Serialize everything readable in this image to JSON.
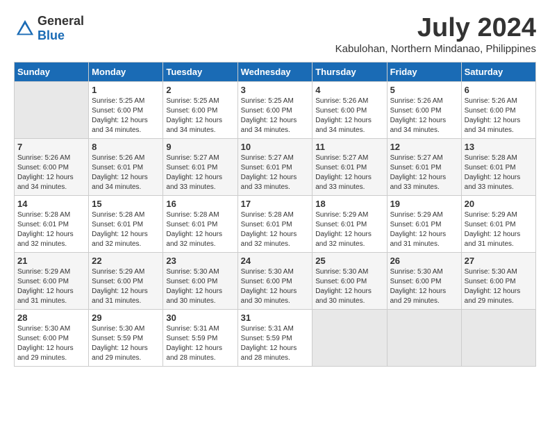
{
  "logo": {
    "text_general": "General",
    "text_blue": "Blue"
  },
  "title": {
    "month_year": "July 2024",
    "location": "Kabulohan, Northern Mindanao, Philippines"
  },
  "calendar": {
    "days_of_week": [
      "Sunday",
      "Monday",
      "Tuesday",
      "Wednesday",
      "Thursday",
      "Friday",
      "Saturday"
    ],
    "weeks": [
      [
        {
          "day": "",
          "info": ""
        },
        {
          "day": "1",
          "info": "Sunrise: 5:25 AM\nSunset: 6:00 PM\nDaylight: 12 hours\nand 34 minutes."
        },
        {
          "day": "2",
          "info": "Sunrise: 5:25 AM\nSunset: 6:00 PM\nDaylight: 12 hours\nand 34 minutes."
        },
        {
          "day": "3",
          "info": "Sunrise: 5:25 AM\nSunset: 6:00 PM\nDaylight: 12 hours\nand 34 minutes."
        },
        {
          "day": "4",
          "info": "Sunrise: 5:26 AM\nSunset: 6:00 PM\nDaylight: 12 hours\nand 34 minutes."
        },
        {
          "day": "5",
          "info": "Sunrise: 5:26 AM\nSunset: 6:00 PM\nDaylight: 12 hours\nand 34 minutes."
        },
        {
          "day": "6",
          "info": "Sunrise: 5:26 AM\nSunset: 6:00 PM\nDaylight: 12 hours\nand 34 minutes."
        }
      ],
      [
        {
          "day": "7",
          "info": "Sunrise: 5:26 AM\nSunset: 6:00 PM\nDaylight: 12 hours\nand 34 minutes."
        },
        {
          "day": "8",
          "info": "Sunrise: 5:26 AM\nSunset: 6:01 PM\nDaylight: 12 hours\nand 34 minutes."
        },
        {
          "day": "9",
          "info": "Sunrise: 5:27 AM\nSunset: 6:01 PM\nDaylight: 12 hours\nand 33 minutes."
        },
        {
          "day": "10",
          "info": "Sunrise: 5:27 AM\nSunset: 6:01 PM\nDaylight: 12 hours\nand 33 minutes."
        },
        {
          "day": "11",
          "info": "Sunrise: 5:27 AM\nSunset: 6:01 PM\nDaylight: 12 hours\nand 33 minutes."
        },
        {
          "day": "12",
          "info": "Sunrise: 5:27 AM\nSunset: 6:01 PM\nDaylight: 12 hours\nand 33 minutes."
        },
        {
          "day": "13",
          "info": "Sunrise: 5:28 AM\nSunset: 6:01 PM\nDaylight: 12 hours\nand 33 minutes."
        }
      ],
      [
        {
          "day": "14",
          "info": "Sunrise: 5:28 AM\nSunset: 6:01 PM\nDaylight: 12 hours\nand 32 minutes."
        },
        {
          "day": "15",
          "info": "Sunrise: 5:28 AM\nSunset: 6:01 PM\nDaylight: 12 hours\nand 32 minutes."
        },
        {
          "day": "16",
          "info": "Sunrise: 5:28 AM\nSunset: 6:01 PM\nDaylight: 12 hours\nand 32 minutes."
        },
        {
          "day": "17",
          "info": "Sunrise: 5:28 AM\nSunset: 6:01 PM\nDaylight: 12 hours\nand 32 minutes."
        },
        {
          "day": "18",
          "info": "Sunrise: 5:29 AM\nSunset: 6:01 PM\nDaylight: 12 hours\nand 32 minutes."
        },
        {
          "day": "19",
          "info": "Sunrise: 5:29 AM\nSunset: 6:01 PM\nDaylight: 12 hours\nand 31 minutes."
        },
        {
          "day": "20",
          "info": "Sunrise: 5:29 AM\nSunset: 6:01 PM\nDaylight: 12 hours\nand 31 minutes."
        }
      ],
      [
        {
          "day": "21",
          "info": "Sunrise: 5:29 AM\nSunset: 6:00 PM\nDaylight: 12 hours\nand 31 minutes."
        },
        {
          "day": "22",
          "info": "Sunrise: 5:29 AM\nSunset: 6:00 PM\nDaylight: 12 hours\nand 31 minutes."
        },
        {
          "day": "23",
          "info": "Sunrise: 5:30 AM\nSunset: 6:00 PM\nDaylight: 12 hours\nand 30 minutes."
        },
        {
          "day": "24",
          "info": "Sunrise: 5:30 AM\nSunset: 6:00 PM\nDaylight: 12 hours\nand 30 minutes."
        },
        {
          "day": "25",
          "info": "Sunrise: 5:30 AM\nSunset: 6:00 PM\nDaylight: 12 hours\nand 30 minutes."
        },
        {
          "day": "26",
          "info": "Sunrise: 5:30 AM\nSunset: 6:00 PM\nDaylight: 12 hours\nand 29 minutes."
        },
        {
          "day": "27",
          "info": "Sunrise: 5:30 AM\nSunset: 6:00 PM\nDaylight: 12 hours\nand 29 minutes."
        }
      ],
      [
        {
          "day": "28",
          "info": "Sunrise: 5:30 AM\nSunset: 6:00 PM\nDaylight: 12 hours\nand 29 minutes."
        },
        {
          "day": "29",
          "info": "Sunrise: 5:30 AM\nSunset: 5:59 PM\nDaylight: 12 hours\nand 29 minutes."
        },
        {
          "day": "30",
          "info": "Sunrise: 5:31 AM\nSunset: 5:59 PM\nDaylight: 12 hours\nand 28 minutes."
        },
        {
          "day": "31",
          "info": "Sunrise: 5:31 AM\nSunset: 5:59 PM\nDaylight: 12 hours\nand 28 minutes."
        },
        {
          "day": "",
          "info": ""
        },
        {
          "day": "",
          "info": ""
        },
        {
          "day": "",
          "info": ""
        }
      ]
    ]
  }
}
